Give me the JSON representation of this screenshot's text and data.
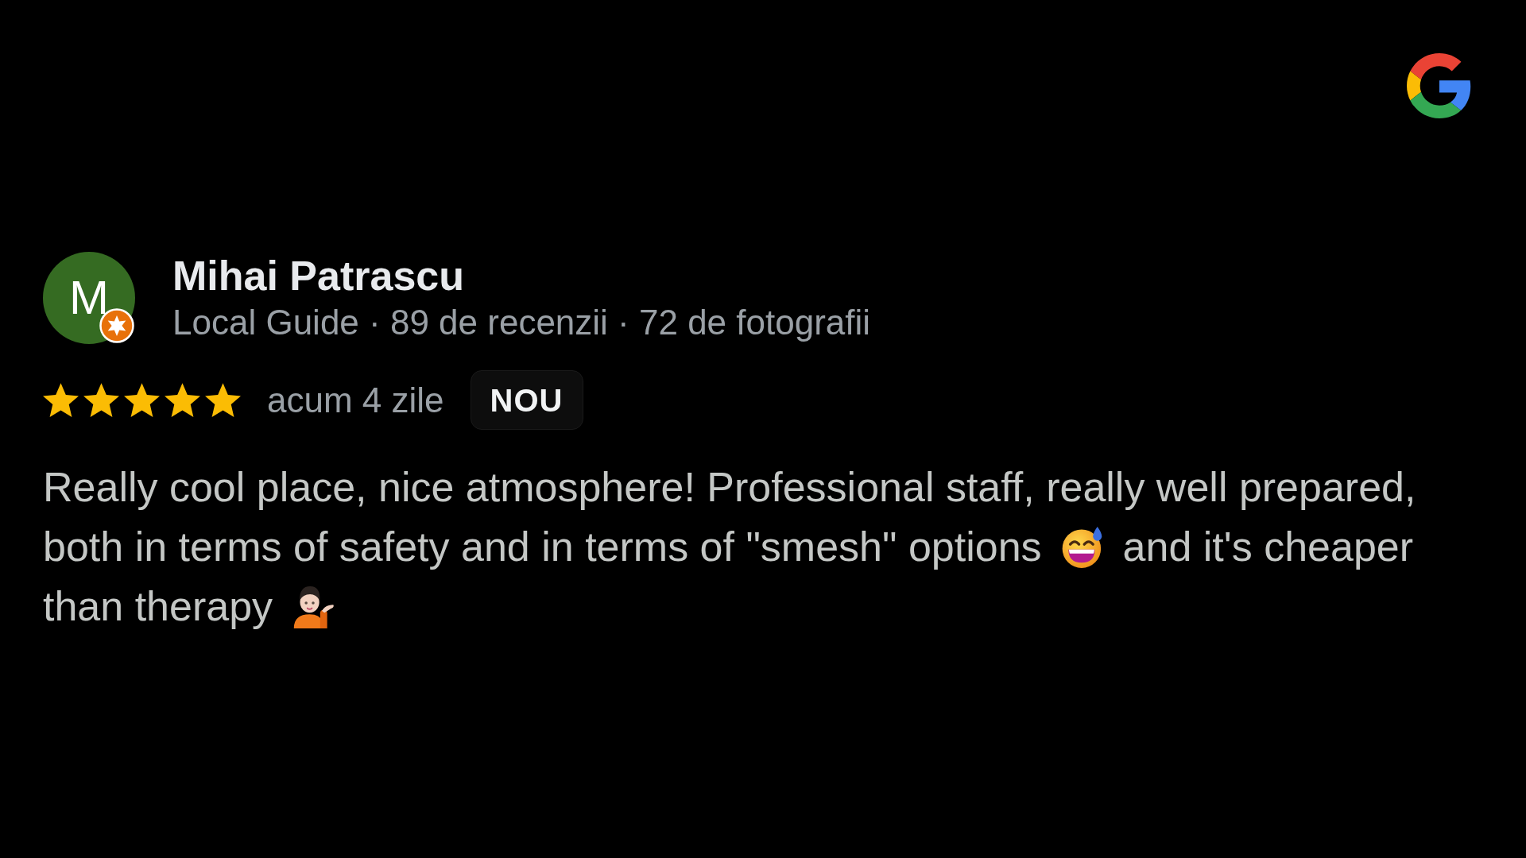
{
  "reviewer": {
    "initial": "M",
    "name": "Mihai Patrascu",
    "details": "Local Guide · 89 de recenzii · 72 de fotografii"
  },
  "review": {
    "stars": 5,
    "time": "acum 4 zile",
    "badge": "NOU",
    "lines": [
      [
        {
          "kind": "text",
          "text": "Really cool place, nice atmosphere! Professional staff, really well prepared,"
        }
      ],
      [
        {
          "kind": "text",
          "text": "both in terms of safety and in terms of \"smesh\" options"
        },
        {
          "kind": "emoji"
        },
        {
          "kind": "text",
          "text": "and it's cheaper"
        }
      ],
      [
        {
          "kind": "text",
          "text": "than therapy"
        },
        {
          "kind": "emoji"
        }
      ]
    ]
  }
}
